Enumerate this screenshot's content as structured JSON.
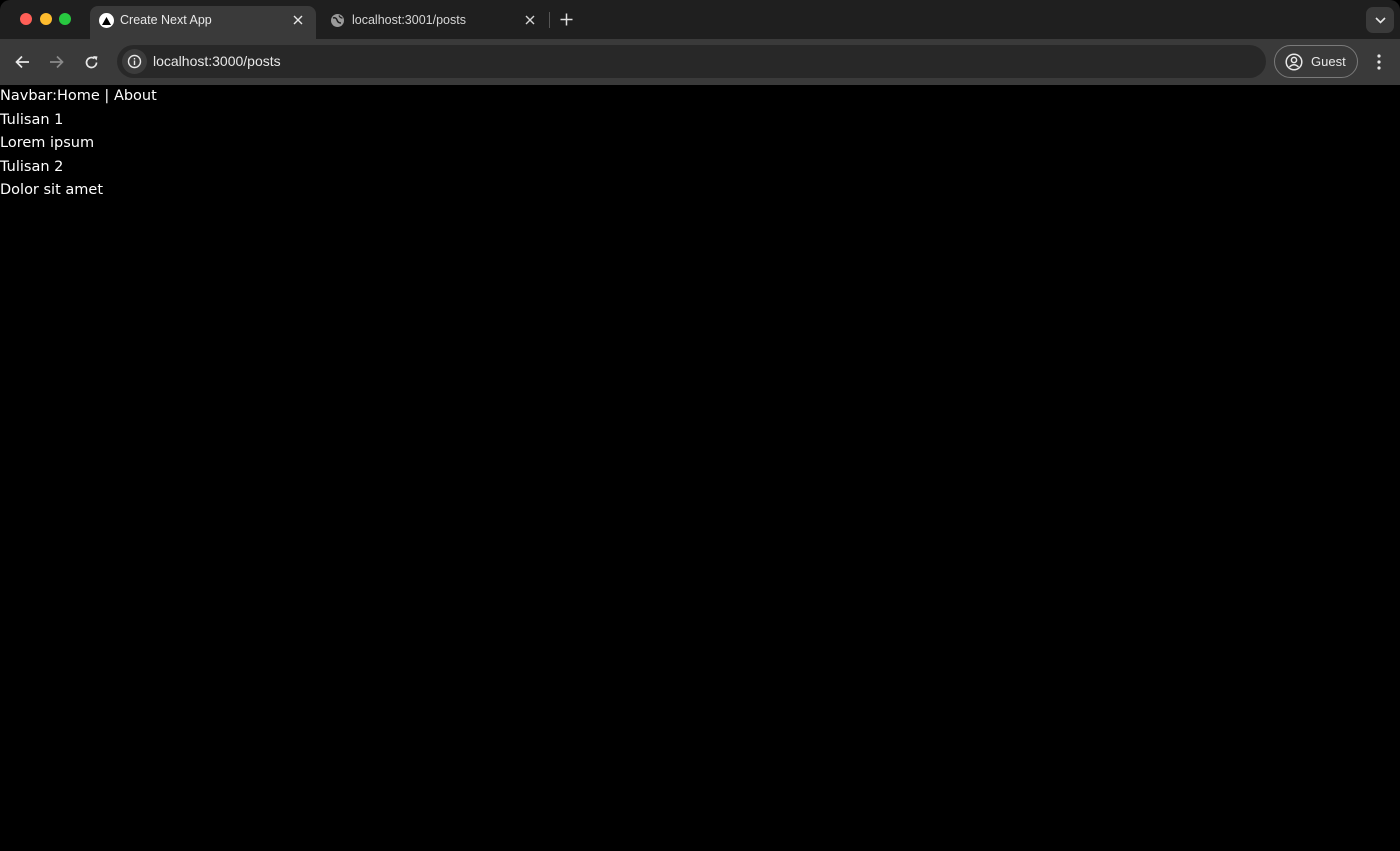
{
  "browser": {
    "tabs": [
      {
        "title": "Create Next App",
        "active": true,
        "favicon": "nextjs-triangle-icon"
      },
      {
        "title": "localhost:3001/posts",
        "active": false,
        "favicon": "globe-icon"
      }
    ],
    "url": "localhost:3000/posts",
    "profile_label": "Guest",
    "colors": {
      "tabstrip_bg": "#1f1f1f",
      "toolbar_bg": "#3a3a3a",
      "omnibox_bg": "#282828",
      "page_bg": "#000000",
      "page_text": "#ffffff"
    }
  },
  "page": {
    "navbar": {
      "prefix": "Navbar:",
      "home": "Home",
      "separator": " | ",
      "about": "About"
    },
    "posts": [
      {
        "title": "Tulisan 1",
        "body": "Lorem ipsum"
      },
      {
        "title": "Tulisan 2",
        "body": "Dolor sit amet"
      }
    ]
  }
}
